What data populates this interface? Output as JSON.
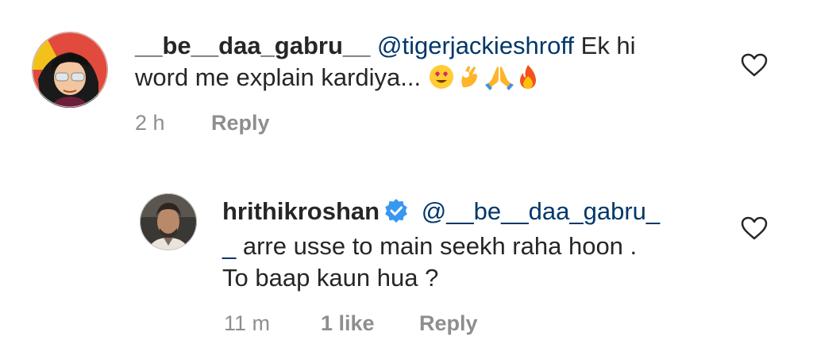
{
  "comments": [
    {
      "username": "__be__daa_gabru__",
      "mention": "@tigerjackieshroff",
      "text_line1_rest": " Ek hi",
      "text_line2": "word me explain kardiya...",
      "emojis": [
        "heart-eyes-emoji",
        "ok-hand-emoji",
        "folded-hands-emoji",
        "fire-emoji"
      ],
      "time": "2 h",
      "reply_label": "Reply"
    },
    {
      "username": "hrithikroshan",
      "verified": true,
      "mention_line1": "@__be__daa_gabru_",
      "mention_line2": "_",
      "text_line2_rest": " arre usse to main seekh raha hoon .",
      "text_line3": "To baap kaun hua ?",
      "time": "11 m",
      "likes": "1 like",
      "reply_label": "Reply"
    }
  ],
  "colors": {
    "text": "#262626",
    "mention": "#00376b",
    "meta": "#8e8e8e",
    "verified": "#3897f0"
  },
  "icons": {
    "like": "heart-outline-icon",
    "verified": "verified-badge-icon"
  }
}
